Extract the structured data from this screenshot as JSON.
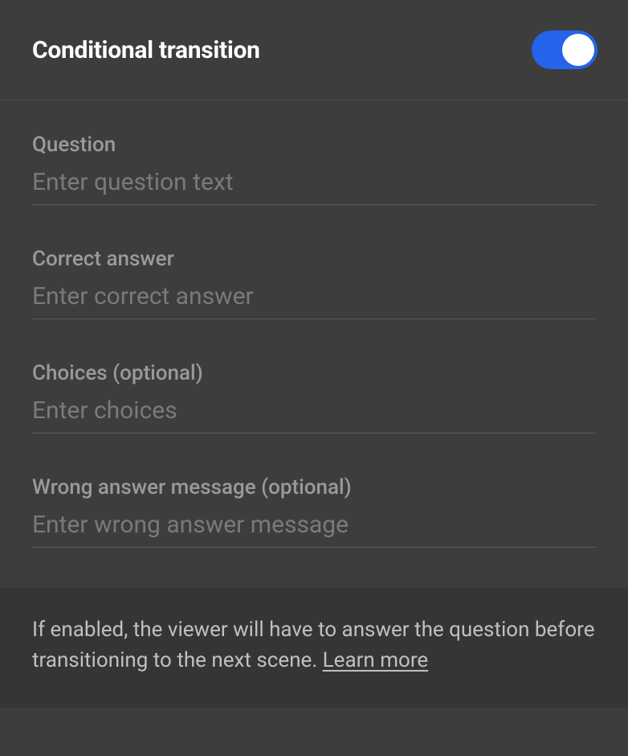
{
  "header": {
    "title": "Conditional transition",
    "toggle_enabled": true
  },
  "fields": {
    "question": {
      "label": "Question",
      "placeholder": "Enter question text",
      "value": ""
    },
    "correct_answer": {
      "label": "Correct answer",
      "placeholder": "Enter correct answer",
      "value": ""
    },
    "choices": {
      "label": "Choices (optional)",
      "placeholder": "Enter choices",
      "value": ""
    },
    "wrong_answer_message": {
      "label": "Wrong answer message (optional)",
      "placeholder": "Enter wrong answer message",
      "value": ""
    }
  },
  "footer": {
    "description": "If enabled, the viewer will have to answer the question before transitioning to the next scene. ",
    "learn_more_label": "Learn more"
  }
}
